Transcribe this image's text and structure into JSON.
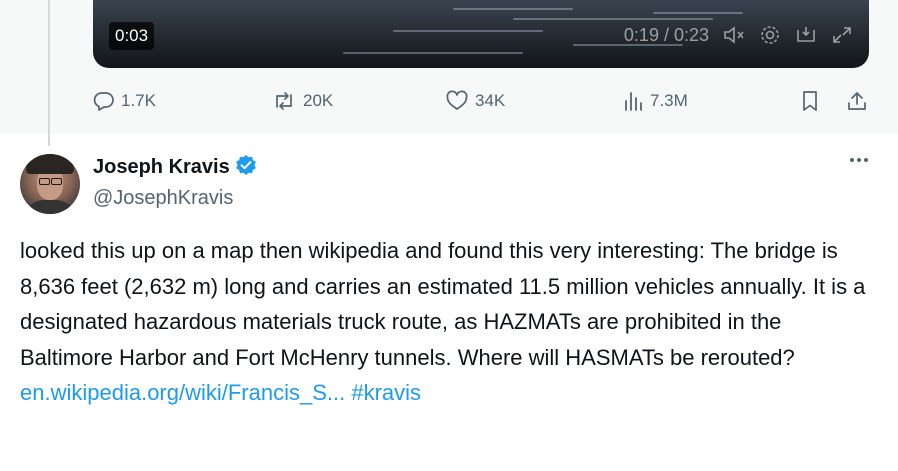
{
  "video": {
    "elapsed_badge": "0:03",
    "time_readout": "0:19 / 0:23"
  },
  "actions": {
    "replies": "1.7K",
    "reposts": "20K",
    "likes": "34K",
    "views": "7.3M"
  },
  "tweet": {
    "display_name": "Joseph Kravis",
    "handle": "@JosephKravis",
    "text": "looked this up on a map then wikipedia and found this very interesting: The bridge is 8,636 feet (2,632 m) long and carries an estimated 11.5 million vehicles annually. It is a designated hazardous materials truck route, as HAZMATs are prohibited in the Baltimore Harbor and Fort McHenry tunnels. Where will HASMATs be rerouted?",
    "link_text": "en.wikipedia.org/wiki/Francis_S...",
    "hashtag": "#kravis"
  },
  "colors": {
    "link": "#1d9bf0",
    "verified_badge": "#1d9bf0",
    "muted_text": "#536471"
  },
  "icons": [
    "reply-icon",
    "repost-icon",
    "like-icon",
    "views-icon",
    "bookmark-icon",
    "share-icon",
    "mute-icon",
    "settings-icon",
    "pip-icon",
    "fullscreen-icon",
    "verified-badge-icon",
    "more-icon"
  ]
}
